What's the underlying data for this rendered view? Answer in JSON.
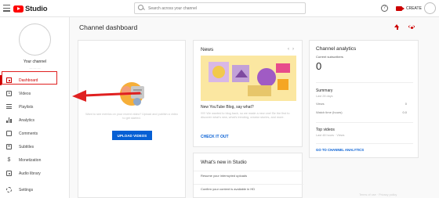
{
  "topbar": {
    "logo_text": "Studio",
    "search_placeholder": "Search across your channel",
    "help_icon": "?",
    "create_label": "CREATE"
  },
  "sidebar": {
    "channel_label": "Your channel",
    "items": [
      {
        "label": "Dashboard",
        "icon": "dashboard-icon",
        "active": true
      },
      {
        "label": "Videos",
        "icon": "videos-icon"
      },
      {
        "label": "Playlists",
        "icon": "playlists-icon"
      },
      {
        "label": "Analytics",
        "icon": "analytics-icon"
      },
      {
        "label": "Comments",
        "icon": "comments-icon"
      },
      {
        "label": "Subtitles",
        "icon": "subtitles-icon"
      },
      {
        "label": "Monetization",
        "icon": "monetization-icon"
      },
      {
        "label": "Audio library",
        "icon": "audio-library-icon"
      },
      {
        "label": "Settings",
        "icon": "gear-icon"
      }
    ]
  },
  "main": {
    "title": "Channel dashboard",
    "upload_card": {
      "text": "Want to see metrics on your recent video? Upload and publish a video to get started.",
      "button": "UPLOAD VIDEOS"
    },
    "news": {
      "title": "News",
      "heading": "New YouTube Blog, say what?",
      "body": "!!!!!! We wanted to blog back, so we made a new one! Be the first to discover what's new, what's trending, creator stories, and more.",
      "link": "CHECK IT OUT"
    },
    "whats_new": {
      "title": "What's new in Studio",
      "items": [
        "Resume your interrupted uploads",
        "Confirm your content is available in HD"
      ]
    },
    "analytics": {
      "title": "Channel analytics",
      "subscribers_label": "Current subscribers",
      "subscribers_value": "0",
      "summary_title": "Summary",
      "summary_period": "Last 28 days",
      "rows": [
        {
          "label": "Views",
          "value": "0"
        },
        {
          "label": "Watch time (hours)",
          "value": "0.0"
        }
      ],
      "top_videos_title": "Top videos",
      "top_videos_period": "Last 48 hours · Views",
      "link": "GO TO CHANNEL ANALYTICS"
    },
    "footer": "Terms of use · Privacy policy"
  },
  "colors": {
    "brand_red": "#ff0000",
    "accent_blue": "#065fd4",
    "annotation_red": "#e02020"
  }
}
